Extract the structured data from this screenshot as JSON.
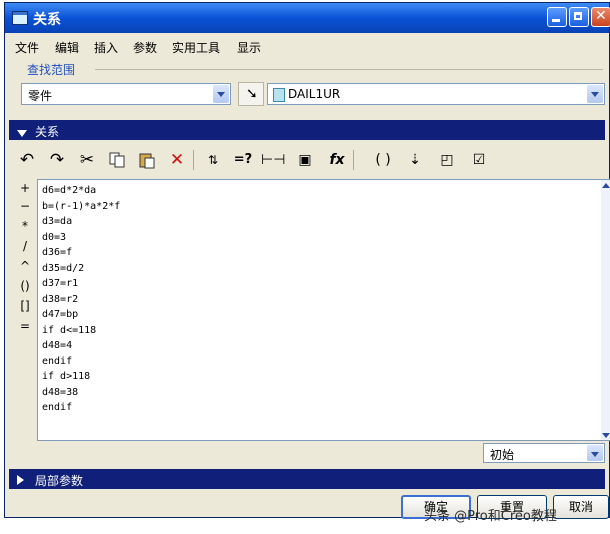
{
  "window": {
    "title": "关系"
  },
  "menu": [
    "文件",
    "编辑",
    "插入",
    "参数",
    "实用工具",
    "显示"
  ],
  "lookin": {
    "group_label": "查找范围",
    "type_value": "零件",
    "model_value": "DAIL1UR"
  },
  "relations": {
    "header": "关系",
    "toolbar_icons": [
      "undo-icon",
      "redo-icon",
      "cut-icon",
      "copy-icon",
      "paste-icon",
      "delete-icon",
      "switch-dimensions-icon",
      "evaluate-icon",
      "display-dimension-icon",
      "insert-parameter-icon",
      "insert-function-icon",
      "parentheses-icon",
      "sort-icon",
      "verify-icon",
      "validate-icon",
      "check-icon"
    ],
    "toolbar_text": {
      "evaluate": "=?",
      "function": "fx",
      "parentheses": "( )"
    },
    "side_ops": [
      "+",
      "−",
      "*",
      "/",
      "^",
      "()",
      "[]",
      "="
    ],
    "lines": [
      "d6=d*2*da",
      "b=(r-1)*a*2*f",
      "d3=da",
      "d0=3",
      "d36=f",
      "d35=d/2",
      "d37=r1",
      "d38=r2",
      "d47=bp",
      "if d<=118",
      "d48=4",
      "endif",
      "if d>118",
      "d48=38",
      "endif"
    ],
    "scope_value": "初始"
  },
  "local_params": {
    "header": "局部参数"
  },
  "buttons": {
    "ok": "确定",
    "reset": "重置",
    "cancel": "取消"
  },
  "watermark": "头条 @Pro和Creo教程"
}
